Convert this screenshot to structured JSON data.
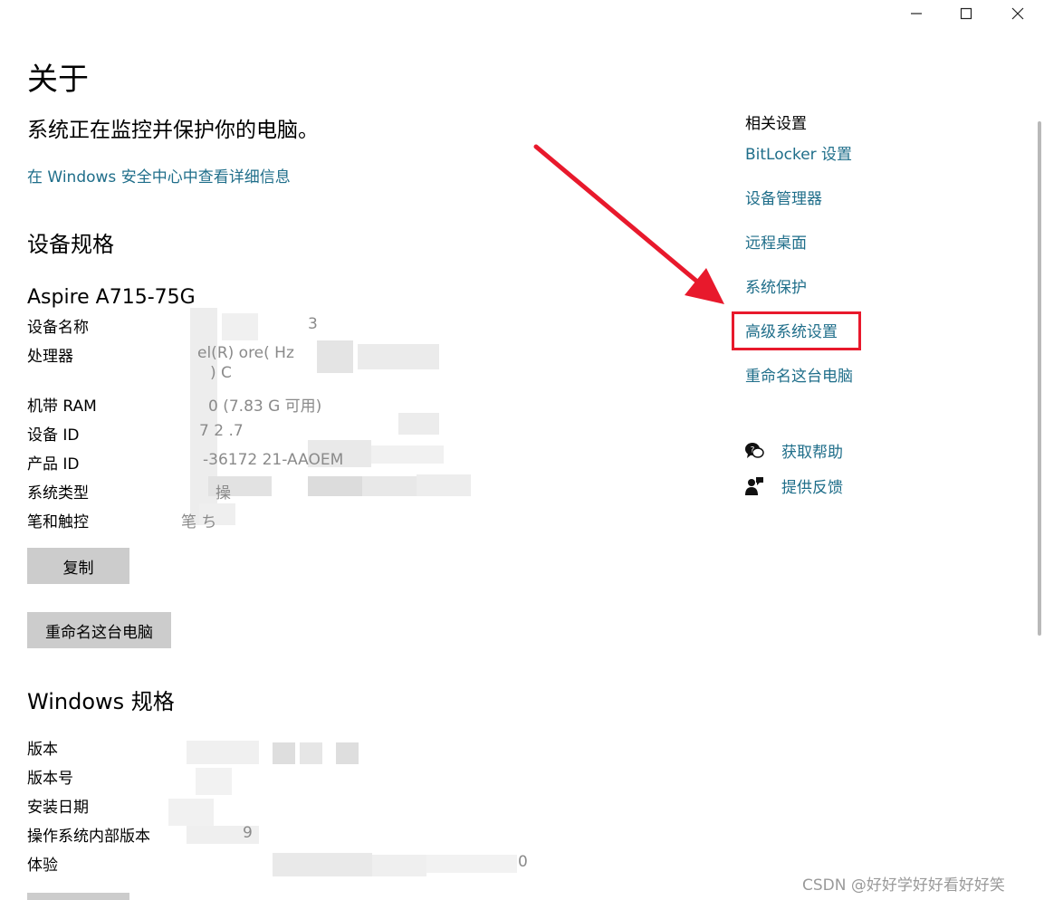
{
  "window": {
    "controls": [
      "minimize-icon",
      "maximize-icon",
      "close-icon"
    ]
  },
  "header": {
    "title": "关于",
    "status": "系统正在监控并保护你的电脑。",
    "security_link": "在 Windows 安全中心中查看详细信息"
  },
  "device_specs": {
    "heading": "设备规格",
    "model": "Aspire A715-75G",
    "rows": [
      {
        "label": "设备名称",
        "value": "3"
      },
      {
        "label": "处理器",
        "value": "el(R) ore(          Hz",
        "value2": ") C"
      },
      {
        "label": "机带 RAM",
        "value": "0    (7.83 G  可用)"
      },
      {
        "label": "设备 ID",
        "value": "7   2                        .7"
      },
      {
        "label": "产品 ID",
        "value": "-36172   21-AAOEM"
      },
      {
        "label": "系统类型",
        "value": "操"
      },
      {
        "label": "笔和触控",
        "value": "笔    ち"
      }
    ],
    "copy_button": "复制",
    "rename_button": "重命名这台电脑"
  },
  "windows_specs": {
    "heading": "Windows 规格",
    "rows": [
      {
        "label": "版本"
      },
      {
        "label": "版本号"
      },
      {
        "label": "安装日期"
      },
      {
        "label": "操作系统内部版本",
        "value": "9"
      },
      {
        "label": "体验",
        "value": "0"
      }
    ]
  },
  "related": {
    "heading": "相关设置",
    "links": [
      "BitLocker 设置",
      "设备管理器",
      "远程桌面",
      "系统保护",
      "高级系统设置",
      "重命名这台电脑"
    ],
    "help": "获取帮助",
    "feedback": "提供反馈"
  },
  "colors": {
    "link": "#1f6e8a",
    "highlight": "#e8192c",
    "button": "#cccccc"
  },
  "watermark": "CSDN @好好学好好看好好笑"
}
